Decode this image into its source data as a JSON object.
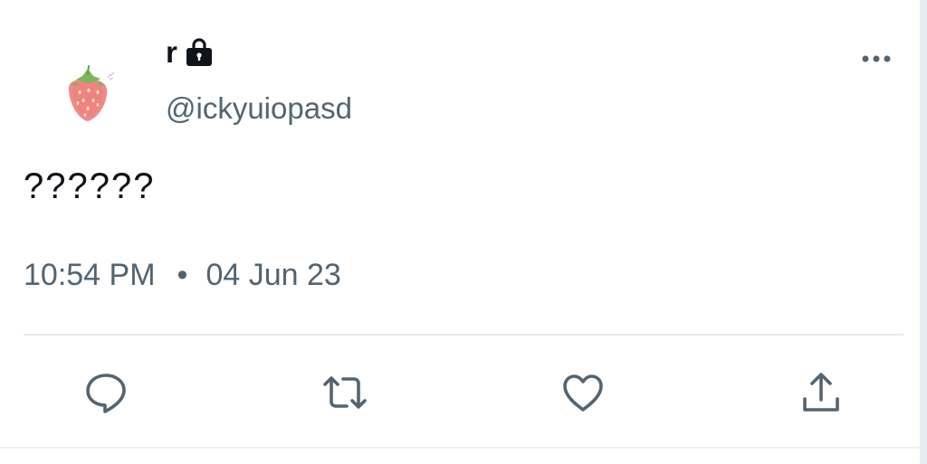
{
  "tweet": {
    "display_name": "r",
    "handle": "@ickyuiopasd",
    "text": "??????",
    "time": "10:54 PM",
    "separator": "•",
    "date": "04 Jun 23"
  },
  "icons": {
    "avatar": "strawberry-avatar",
    "protected": "lock-icon",
    "more": "more-options-icon",
    "reply": "reply-icon",
    "retweet": "retweet-icon",
    "like": "like-icon",
    "share": "share-icon"
  },
  "colors": {
    "text_primary": "#0f1419",
    "text_secondary": "#536471",
    "icon": "#536471",
    "divider": "#e6e9eb"
  }
}
